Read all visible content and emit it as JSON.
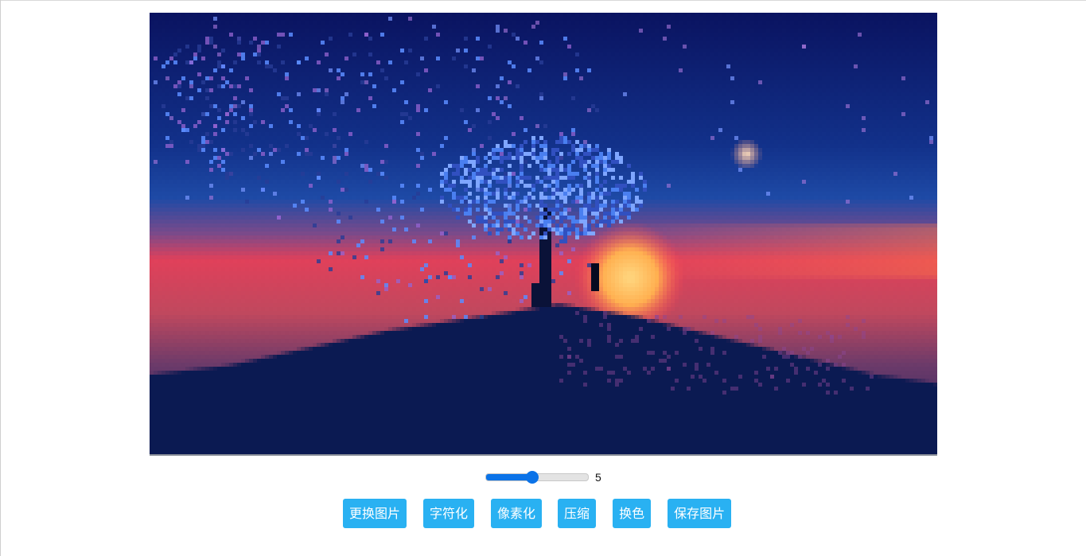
{
  "image": {
    "description_icon": "landscape-image",
    "colors": {
      "sky_top": "#0a1360",
      "sky_mid": "#1e4aa6",
      "horizon": "#e0405a",
      "sun": "#ffb050",
      "hill": "#0b1a52",
      "tree": "#4a7ff0"
    }
  },
  "slider": {
    "value": "5",
    "min": "1",
    "max": "10"
  },
  "buttons": {
    "change_image": "更换图片",
    "to_chars": "字符化",
    "pixelate": "像素化",
    "compress": "压缩",
    "recolor": "换色",
    "save_image": "保存图片"
  },
  "accent": "#29b1f2",
  "slider_accent": "#0b73e8"
}
